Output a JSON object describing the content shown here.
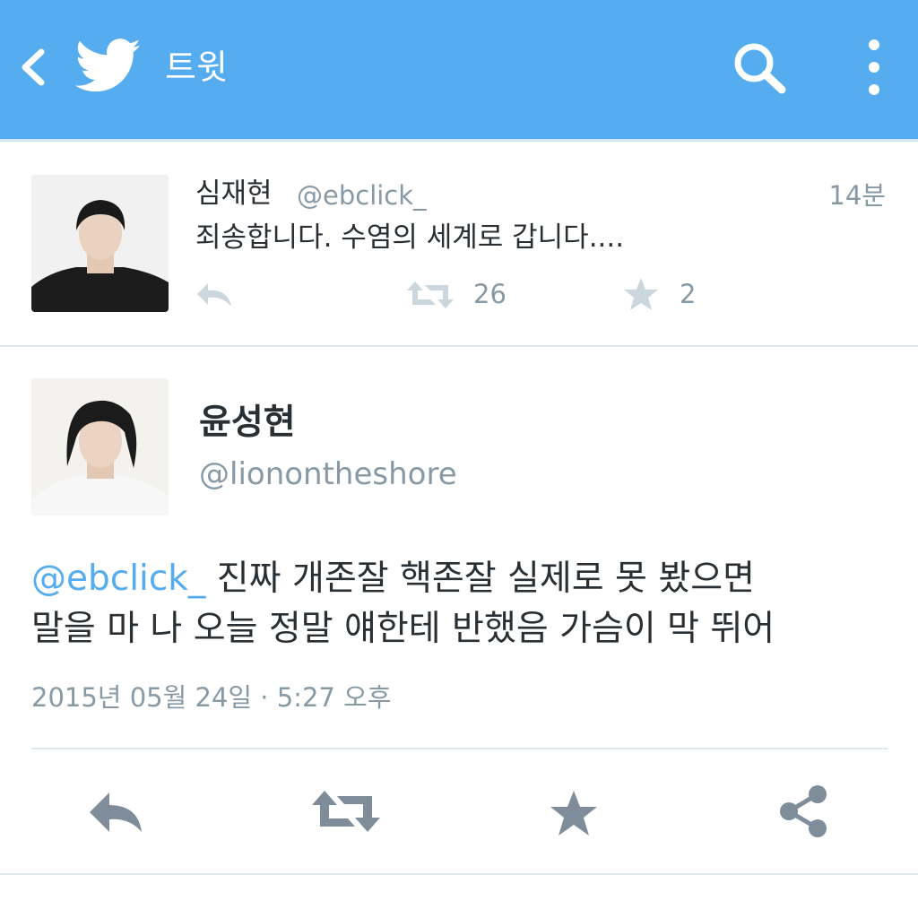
{
  "header": {
    "title": "트윗",
    "bg_color": "#55acee",
    "icons": [
      "back-chevron-icon",
      "twitter-bird-icon",
      "search-icon",
      "more-vertical-icon"
    ]
  },
  "tweet_reply": {
    "display_name": "심재현",
    "handle": "@ebclick_",
    "time": "14분",
    "text": "죄송합니다. 수염의 세계로 갑니다....",
    "retweet_count": "26",
    "favorite_count": "2"
  },
  "tweet_main": {
    "display_name": "윤성현",
    "handle": "@lionontheshore",
    "mention": "@ebclick_",
    "text_line1": " 진짜 개존잘 핵존잘 실제로 못 봤으면",
    "text_line2": "말을 마 나 오늘 정말 얘한테 반했음 가슴이 막 뛰어",
    "timestamp": "2015년 05월 24일 · 5:27 오후"
  },
  "colors": {
    "accent": "#55acee",
    "muted": "#8899a6",
    "icon_gray": "#778899",
    "text": "#292f33",
    "divider": "#e1e8ed"
  }
}
